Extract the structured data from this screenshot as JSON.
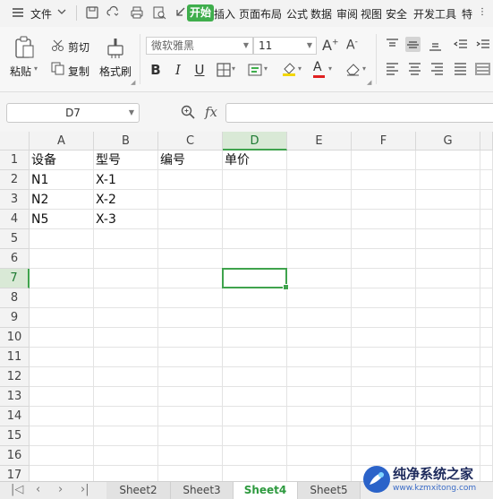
{
  "menubar": {
    "file_label": "文件",
    "tabs": [
      "开始",
      "插入",
      "页面布局",
      "公式",
      "数据",
      "审阅",
      "视图",
      "安全",
      "开发工具",
      "特"
    ],
    "active_tab": "开始"
  },
  "ribbon": {
    "paste_label": "粘贴",
    "cut_label": "剪切",
    "copy_label": "复制",
    "format_painter_label": "格式刷",
    "font_name": "微软雅黑",
    "font_size": "11",
    "grow_font": "A",
    "shrink_font": "A",
    "bold": "B",
    "italic": "I",
    "underline": "U",
    "font_color_letter": "A",
    "accent_green": "#3fae4c",
    "fill_color": "#f2d600",
    "font_color": "#e02020"
  },
  "formula_bar": {
    "name_box": "D7",
    "fx_label": "fx",
    "formula": ""
  },
  "sheet": {
    "columns": [
      "A",
      "B",
      "C",
      "D",
      "E",
      "F",
      "G"
    ],
    "selected_column": "D",
    "rows": [
      "1",
      "2",
      "3",
      "4",
      "5",
      "6",
      "7",
      "8",
      "9",
      "10",
      "11",
      "12",
      "13",
      "14",
      "15",
      "16",
      "17"
    ],
    "selected_row": "7",
    "cells": {
      "A1": "设备",
      "B1": "型号",
      "C1": "编号",
      "D1": "单价",
      "A2": "N1",
      "B2": "X-1",
      "A3": "N2",
      "B3": "X-2",
      "A4": "N5",
      "B4": "X-3"
    },
    "active_cell": "D7"
  },
  "tabs": {
    "sheets": [
      "Sheet2",
      "Sheet3",
      "Sheet4",
      "Sheet5"
    ],
    "active": "Sheet4"
  },
  "watermark": {
    "title": "纯净系统之家",
    "url": "www.kzmxitong.com"
  }
}
